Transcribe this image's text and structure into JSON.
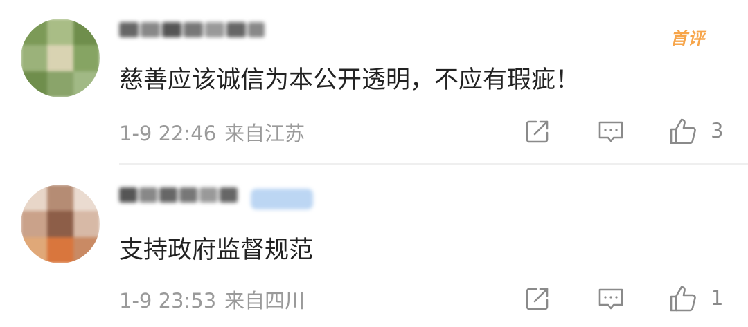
{
  "comments": [
    {
      "first_tag": "首评",
      "text": "慈善应该诚信为本公开透明，不应有瑕疵！",
      "time": "1-9 22:46",
      "location": "来自江苏",
      "likes": "3"
    },
    {
      "text": "支持政府监督规范",
      "time": "1-9 23:53",
      "location": "来自四川",
      "likes": "1"
    }
  ],
  "colors": {
    "text": "#222222",
    "meta": "#9a9a9a",
    "first_tag": "#f7a54a",
    "icon": "#8a8a8a"
  },
  "icons": [
    "share-icon",
    "reply-icon",
    "like-icon"
  ]
}
